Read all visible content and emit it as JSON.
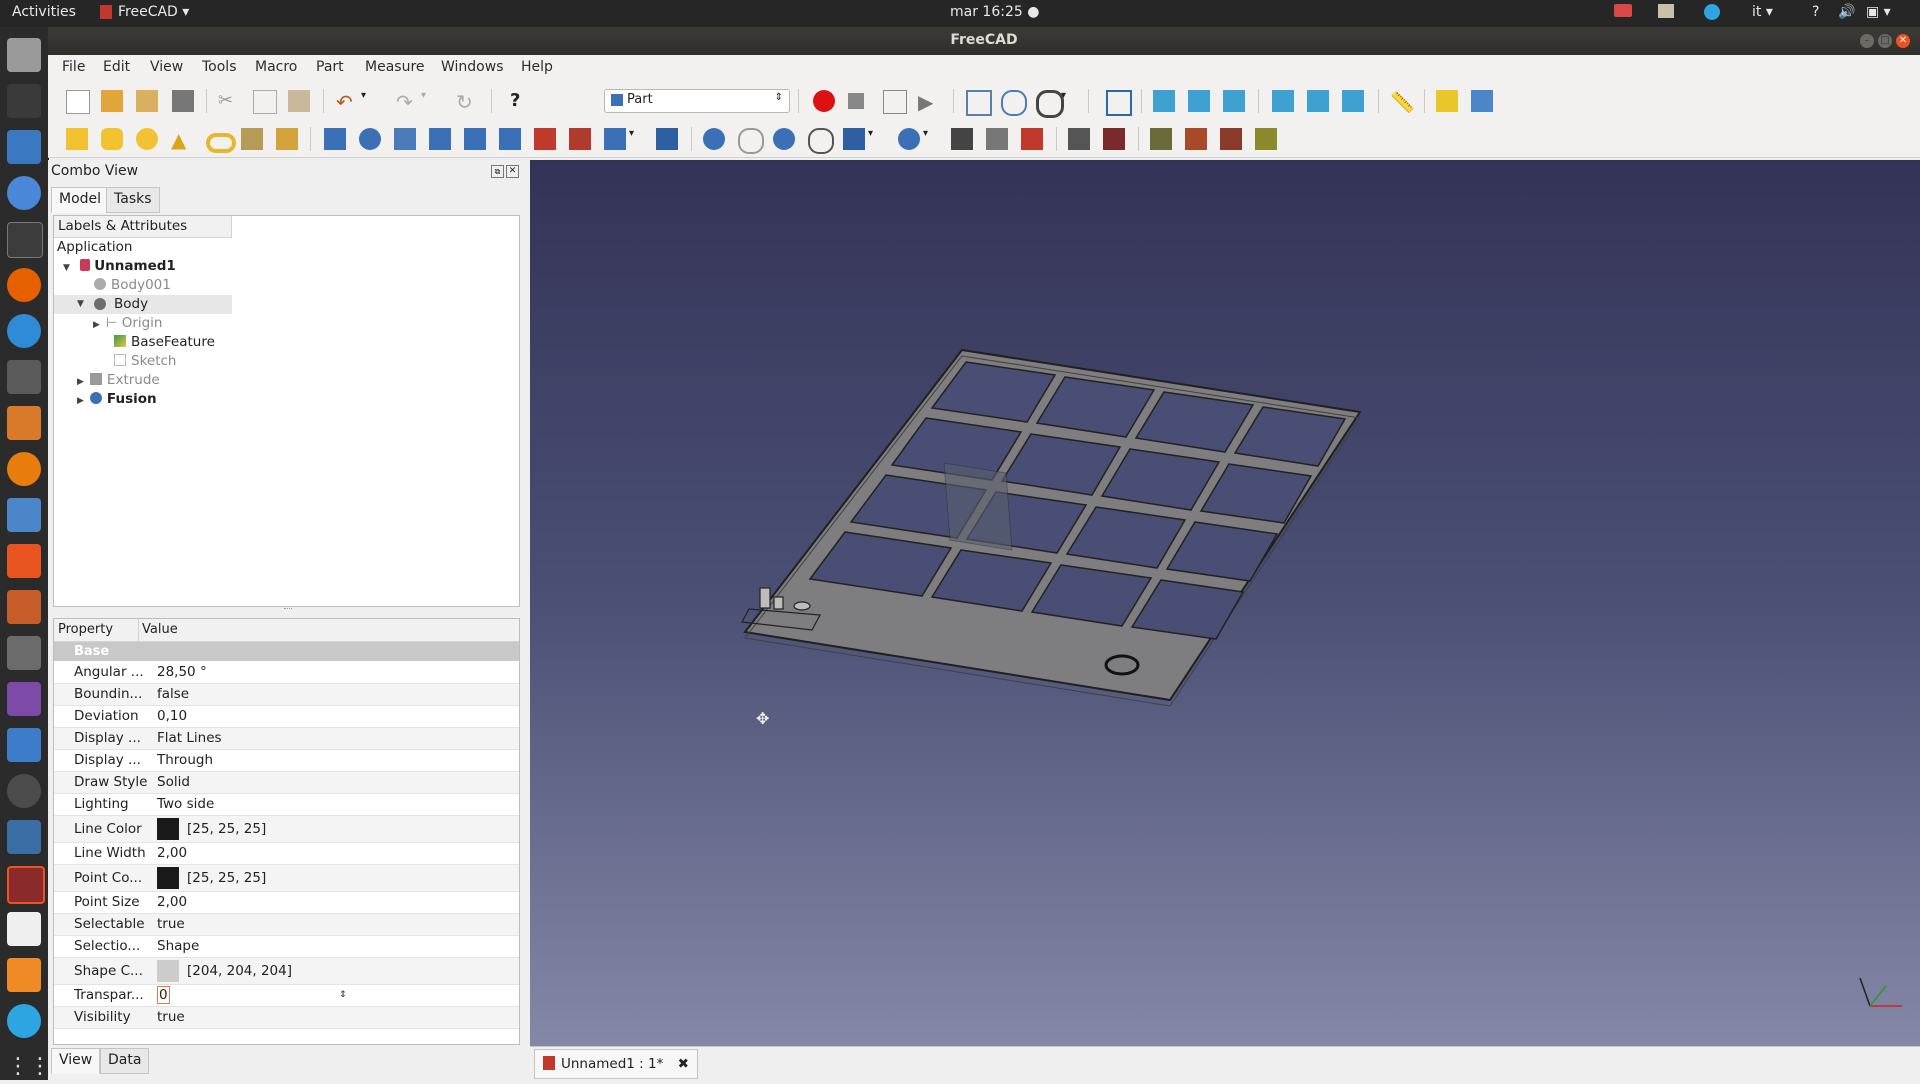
{
  "topbar": {
    "activities": "Activities",
    "app_menu": "FreeCAD",
    "clock": "mar 16:25",
    "lang": "it",
    "help": "?"
  },
  "window": {
    "title": "FreeCAD"
  },
  "menu": [
    "File",
    "Edit",
    "View",
    "Tools",
    "Macro",
    "Part",
    "Measure",
    "Windows",
    "Help"
  ],
  "toolbar": {
    "workbench": "Part"
  },
  "combo": {
    "title": "Combo View",
    "tabs": [
      "Model",
      "Tasks"
    ],
    "tree_header": "Labels & Attributes",
    "tree": {
      "application": "Application",
      "doc": "Unnamed1",
      "body001": "Body001",
      "body": "Body",
      "origin": "Origin",
      "basefeature": "BaseFeature",
      "sketch": "Sketch",
      "extrude": "Extrude",
      "fusion": "Fusion"
    },
    "prop_headers": [
      "Property",
      "Value"
    ],
    "group": "Base",
    "properties": [
      {
        "name": "Angular ...",
        "value": "28,50 °"
      },
      {
        "name": "Boundin...",
        "value": "false"
      },
      {
        "name": "Deviation",
        "value": "0,10"
      },
      {
        "name": "Display ...",
        "value": "Flat Lines"
      },
      {
        "name": "Display ...",
        "value": "Through"
      },
      {
        "name": "Draw Style",
        "value": "Solid"
      },
      {
        "name": "Lighting",
        "value": "Two side"
      },
      {
        "name": "Line Color",
        "value": "[25, 25, 25]",
        "color": "#191919"
      },
      {
        "name": "Line Width",
        "value": "2,00"
      },
      {
        "name": "Point Co...",
        "value": "[25, 25, 25]",
        "color": "#191919"
      },
      {
        "name": "Point Size",
        "value": "2,00"
      },
      {
        "name": "Selectable",
        "value": "true"
      },
      {
        "name": "Selectio...",
        "value": "Shape"
      },
      {
        "name": "Shape C...",
        "value": "[204, 204, 204]",
        "color": "#cccccc"
      },
      {
        "name": "Transpar...",
        "value": "0"
      },
      {
        "name": "Visibility",
        "value": "true"
      }
    ],
    "bottom_tabs": [
      "View",
      "Data"
    ]
  },
  "doc_tab": {
    "label": "Unnamed1 : 1*"
  },
  "colors": {
    "accent": "#e95420",
    "selection": "#f07746"
  }
}
